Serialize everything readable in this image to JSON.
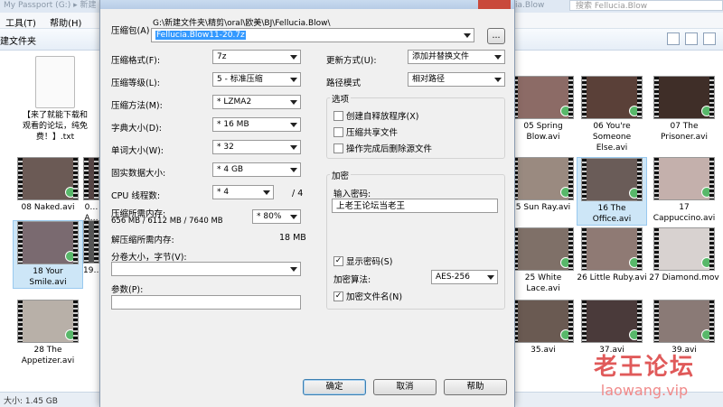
{
  "explorer": {
    "title_fragment": "My Passport (G:) ▸ 新建",
    "title_fragment_right": "ia.Blow",
    "search_placeholder": "搜索 Fellucia.Blow",
    "menu": [
      "工具(T)",
      "帮助(H)"
    ],
    "toolbar_label": "建文件夹",
    "files": [
      {
        "name": "【来了就能下载和观看的论坛，纯免费！】.txt",
        "type": "txt"
      },
      {
        "name": "08 Naked.avi",
        "type": "video"
      },
      {
        "name": "0…A…",
        "type": "video"
      },
      {
        "name": "18 Your Smile.avi",
        "type": "video"
      },
      {
        "name": "19…",
        "type": "video"
      },
      {
        "name": "28 The Appetizer.avi",
        "type": "video"
      },
      {
        "name": "05 Spring Blow.avi",
        "type": "video"
      },
      {
        "name": "06 You're Someone Else.avi",
        "type": "video"
      },
      {
        "name": "07 The Prisoner.avi",
        "type": "video"
      },
      {
        "name": "5 Sun Ray.avi",
        "type": "video"
      },
      {
        "name": "16 The Office.avi",
        "type": "video"
      },
      {
        "name": "17 Cappuccino.avi",
        "type": "video"
      },
      {
        "name": "25 White Lace.avi",
        "type": "video"
      },
      {
        "name": "26 Little Ruby.avi",
        "type": "video"
      },
      {
        "name": "27 Diamond.mov",
        "type": "video"
      },
      {
        "name": "35.avi",
        "type": "video"
      },
      {
        "name": "37.avi",
        "type": "video"
      },
      {
        "name": "39.avi",
        "type": "video"
      }
    ],
    "status": "大小: 1.45 GB",
    "watermark_cn": "老王论坛",
    "watermark_en": "laowang.vip"
  },
  "dialog": {
    "archive_label": "压缩包(A)",
    "archive_path": "G:\\新建文件夹\\精剪\\oral\\欧美\\BJ\\Fellucia.Blow\\",
    "archive_name": "Fellucia.Blow11-20.7z",
    "browse_label": "...",
    "format": {
      "label": "压缩格式(F):",
      "value": "7z"
    },
    "level": {
      "label": "压缩等级(L):",
      "value": "5 - 标准压缩"
    },
    "method": {
      "label": "压缩方法(M):",
      "value": "* LZMA2"
    },
    "dict": {
      "label": "字典大小(D):",
      "value": "* 16 MB"
    },
    "word": {
      "label": "单词大小(W):",
      "value": "* 32"
    },
    "solid": {
      "label": "固实数据大小:",
      "value": "* 4 GB"
    },
    "threads": {
      "label": "CPU 线程数:",
      "value": "* 4",
      "max": "/ 4"
    },
    "mem_compress": {
      "label": "压缩所需内存:",
      "detail": "656 MB / 6112 MB / 7640 MB",
      "value": "* 80%"
    },
    "mem_decompress": {
      "label": "解压缩所需内存:",
      "value": "18 MB"
    },
    "volume": {
      "label": "分卷大小，字节(V):",
      "value": ""
    },
    "params": {
      "label": "参数(P):",
      "value": ""
    },
    "update_mode": {
      "label": "更新方式(U):",
      "value": "添加并替换文件"
    },
    "path_mode": {
      "label": "路径模式",
      "value": "相对路径"
    },
    "options": {
      "title": "选项",
      "items": [
        {
          "label": "创建自释放程序(X)",
          "checked": false
        },
        {
          "label": "压缩共享文件",
          "checked": false
        },
        {
          "label": "操作完成后删除源文件",
          "checked": false
        }
      ]
    },
    "encryption": {
      "title": "加密",
      "password_label": "输入密码:",
      "password_value": "上老王论坛当老王",
      "show_password": {
        "label": "显示密码(S)",
        "checked": true
      },
      "method_label": "加密算法:",
      "method_value": "AES-256",
      "encrypt_names": {
        "label": "加密文件名(N)",
        "checked": true
      }
    },
    "buttons": {
      "ok": "确定",
      "cancel": "取消",
      "help": "帮助"
    }
  },
  "colors": {
    "selection": "#3399ff",
    "accent_red": "#c9493b",
    "watermark": "#e05a5a"
  }
}
